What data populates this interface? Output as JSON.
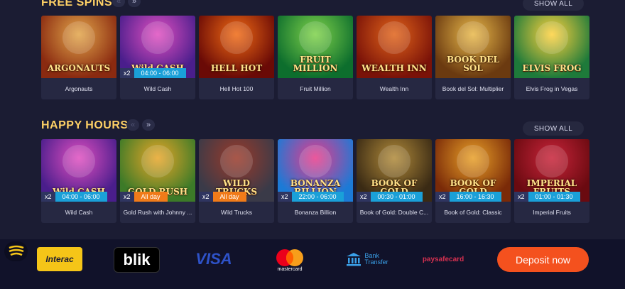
{
  "free_spins": {
    "title": "FREE SPINS",
    "show_all": "SHOW ALL",
    "prev_arrow": "«",
    "next_arrow": "»",
    "games": [
      {
        "name": "Argonauts",
        "art_text": "ARGONAUTS",
        "bg": "#8a2a10",
        "bg2": "#e2a54a",
        "badge": null
      },
      {
        "name": "Wild Cash",
        "art_text": "Wild CASH",
        "bg": "#4a1e8c",
        "bg2": "#e04fc0",
        "badge": {
          "mult": "x2",
          "time": "04:00 - 06:00",
          "color": "blue"
        }
      },
      {
        "name": "Hell Hot 100",
        "art_text": "HELL HOT",
        "bg": "#6a0a06",
        "bg2": "#f06a14",
        "badge": null
      },
      {
        "name": "Fruit Million",
        "art_text": "FRUIT MILLION",
        "bg": "#0d6e2d",
        "bg2": "#7fd24a",
        "badge": null
      },
      {
        "name": "Wealth Inn",
        "art_text": "WEALTH INN",
        "bg": "#7a1208",
        "bg2": "#e0631a",
        "badge": null
      },
      {
        "name": "Book del Sol: Multiplier",
        "art_text": "BOOK DEL SOL",
        "bg": "#6b3a10",
        "bg2": "#e8b84a",
        "badge": null
      },
      {
        "name": "Elvis Frog in Vegas",
        "art_text": "ELVIS FROG",
        "bg": "#1e7a3a",
        "bg2": "#ffd23f",
        "badge": null
      }
    ]
  },
  "happy_hours": {
    "title": "HAPPY HOURS",
    "show_all": "SHOW ALL",
    "prev_arrow": "«",
    "next_arrow": "»",
    "games": [
      {
        "name": "Wild Cash",
        "art_text": "Wild CASH",
        "bg": "#4a1e8c",
        "bg2": "#e04fc0",
        "badge": {
          "mult": "x2",
          "time": "04:00 - 06:00",
          "color": "blue"
        }
      },
      {
        "name": "Gold Rush with Johnny ...",
        "art_text": "GOLD RUSH",
        "bg": "#3c7a28",
        "bg2": "#e8a628",
        "badge": {
          "mult": "x2",
          "time": "All day",
          "color": "orange"
        }
      },
      {
        "name": "Wild Trucks",
        "art_text": "WILD TRUCKS",
        "bg": "#3a3a48",
        "bg2": "#9a3a2a",
        "badge": {
          "mult": "x2",
          "time": "All day",
          "color": "orange"
        }
      },
      {
        "name": "Bonanza Billion",
        "art_text": "BONANZA BILLION",
        "bg": "#1c7ad6",
        "bg2": "#e83a8a",
        "badge": {
          "mult": "x2",
          "time": "22:00 - 06:00",
          "color": "blue"
        }
      },
      {
        "name": "Book of Gold: Double C...",
        "art_text": "BOOK OF GOLD",
        "bg": "#3a2a14",
        "bg2": "#b08a3a",
        "badge": {
          "mult": "x2",
          "time": "00:30 - 01:00",
          "color": "blue"
        }
      },
      {
        "name": "Book of Gold: Classic",
        "art_text": "BOOK OF GOLD",
        "bg": "#7a2a08",
        "bg2": "#e8a028",
        "badge": {
          "mult": "x2",
          "time": "16:00 - 16:30",
          "color": "blue"
        }
      },
      {
        "name": "Imperial Fruits",
        "art_text": "IMPERIAL FRUITS",
        "bg": "#6a0a10",
        "bg2": "#c8243a",
        "badge": {
          "mult": "x2",
          "time": "01:00 - 01:30",
          "color": "blue"
        }
      }
    ]
  },
  "footer": {
    "interac": "Interac",
    "blik": "blik",
    "visa": "VISA",
    "mastercard": "mastercard",
    "bank_transfer_line1": "Bank",
    "bank_transfer_line2": "Transfer",
    "paysafecard": "paysafecard",
    "deposit": "Deposit now",
    "menu_icon": "logo-menu-icon"
  },
  "colors": {
    "background": "#1b1c33",
    "section_title": "#ffd166",
    "badge_blue": "#1aa0d8",
    "badge_orange": "#f07b19",
    "deposit": "#f4511e"
  }
}
